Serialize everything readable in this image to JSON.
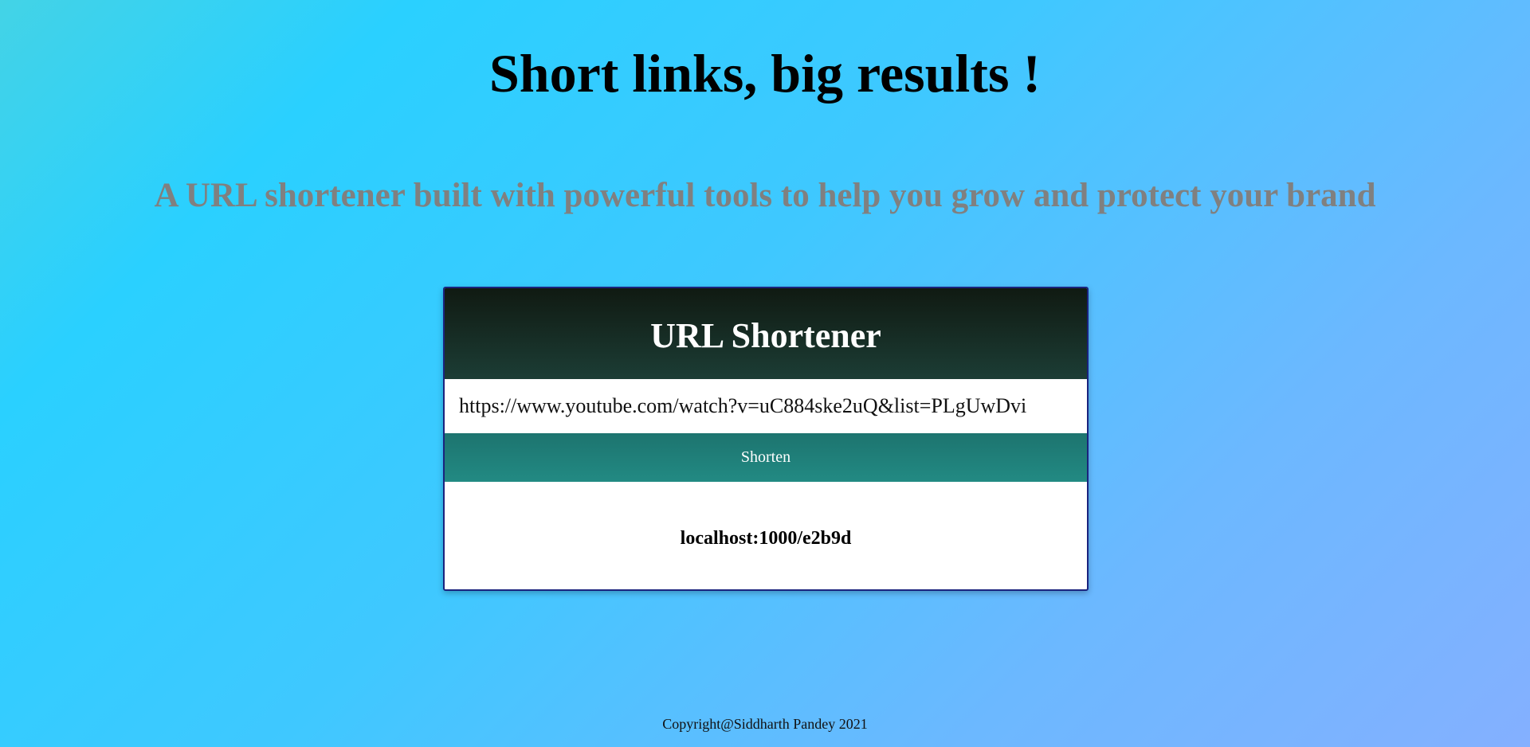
{
  "hero": {
    "title": "Short links, big results !",
    "subtitle": "A URL shortener built with powerful tools to help you grow and protect your brand"
  },
  "card": {
    "title": "URL Shortener",
    "input_value": "https://www.youtube.com/watch?v=uC884ske2uQ&list=PLgUwDvi",
    "button_label": "Shorten",
    "result": "localhost:1000/e2b9d"
  },
  "footer": {
    "copyright": "Copyright@Siddharth Pandey 2021"
  }
}
